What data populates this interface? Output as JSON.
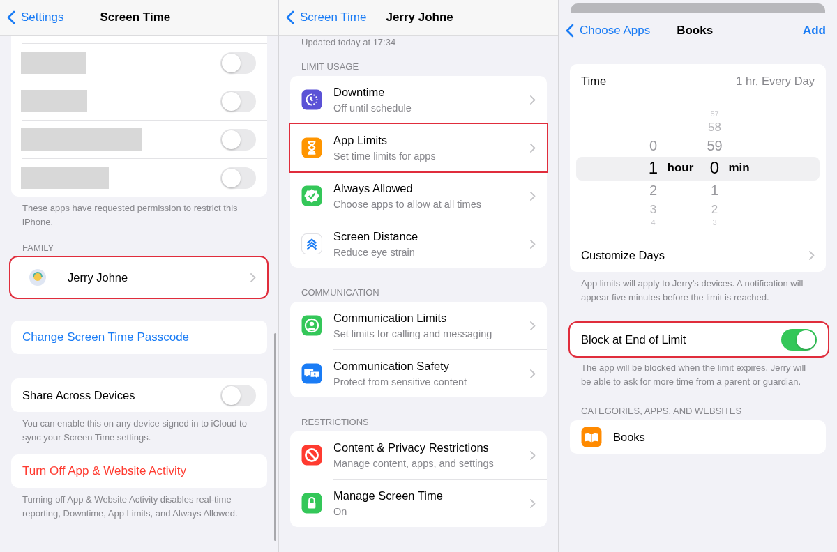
{
  "screen_time": {
    "nav": {
      "back": "Settings",
      "title": "Screen Time"
    },
    "permission_apps": [
      {
        "on": false
      },
      {
        "on": false
      },
      {
        "on": false
      },
      {
        "on": false
      }
    ],
    "permission_note": "These apps have requested permission to restrict this iPhone.",
    "family_header": "FAMILY",
    "family": [
      {
        "name": "Jerry Johne",
        "highlighted": true
      }
    ],
    "passcode_link": "Change Screen Time Passcode",
    "share": {
      "label": "Share Across Devices",
      "on": false
    },
    "share_note": "You can enable this on any device signed in to iCloud to sync your Screen Time settings.",
    "turn_off": "Turn Off App & Website Activity",
    "turn_off_note": "Turning off App & Website Activity disables real-time reporting, Downtime, App Limits, and Always Allowed."
  },
  "child_detail": {
    "nav": {
      "back": "Screen Time",
      "title": "Jerry Johne"
    },
    "updated": "Updated today at 17:34",
    "sections": [
      {
        "header": "LIMIT USAGE",
        "items": [
          {
            "kind": "downtime",
            "title": "Downtime",
            "subtitle": "Off until schedule",
            "highlighted": false
          },
          {
            "kind": "app-limits",
            "title": "App Limits",
            "subtitle": "Set time limits for apps",
            "highlighted": true
          },
          {
            "kind": "always-allowed",
            "title": "Always Allowed",
            "subtitle": "Choose apps to allow at all times",
            "highlighted": false
          },
          {
            "kind": "screen-distance",
            "title": "Screen Distance",
            "subtitle": "Reduce eye strain",
            "highlighted": false
          }
        ]
      },
      {
        "header": "COMMUNICATION",
        "items": [
          {
            "kind": "communication-limits",
            "title": "Communication Limits",
            "subtitle": "Set limits for calling and messaging",
            "highlighted": false
          },
          {
            "kind": "communication-safety",
            "title": "Communication Safety",
            "subtitle": "Protect from sensitive content",
            "highlighted": false
          }
        ]
      },
      {
        "header": "RESTRICTIONS",
        "items": [
          {
            "kind": "content-restrictions",
            "title": "Content & Privacy Restrictions",
            "subtitle": "Manage content, apps, and settings",
            "highlighted": false
          },
          {
            "kind": "manage",
            "title": "Manage Screen Time",
            "subtitle": "On",
            "highlighted": false
          }
        ]
      }
    ]
  },
  "app_limit": {
    "nav": {
      "back": "Choose Apps",
      "title": "Books",
      "action": "Add"
    },
    "time": {
      "label": "Time",
      "value": "1 hr, Every Day"
    },
    "picker": {
      "columns": [
        {
          "unit": "hour",
          "items": [
            {
              "label": "0",
              "selected": false
            },
            {
              "label": "1",
              "selected": true
            },
            {
              "label": "2",
              "selected": false
            },
            {
              "label": "3",
              "selected": false
            },
            {
              "label": "4",
              "selected": false
            }
          ]
        },
        {
          "unit": "min",
          "items": [
            {
              "label": "57",
              "selected": false
            },
            {
              "label": "58",
              "selected": false
            },
            {
              "label": "59",
              "selected": false
            },
            {
              "label": "0",
              "selected": true
            },
            {
              "label": "1",
              "selected": false
            },
            {
              "label": "2",
              "selected": false
            },
            {
              "label": "3",
              "selected": false
            }
          ]
        }
      ]
    },
    "customize": "Customize Days",
    "limit_note": "App limits will apply to Jerry’s devices. A notification will appear five minutes before the limit is reached.",
    "block": {
      "label": "Block at End of Limit",
      "on": true,
      "highlighted": true
    },
    "block_note": "The app will be blocked when the limit expires. Jerry will be able to ask for more time from a parent or guardian.",
    "categories_header": "CATEGORIES, APPS, AND WEBSITES",
    "apps": [
      {
        "kind": "books",
        "name": "Books"
      }
    ]
  }
}
